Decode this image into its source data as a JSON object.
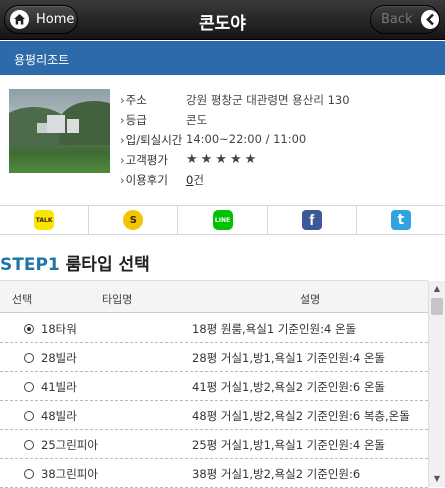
{
  "header": {
    "home_label": "Home",
    "title": "콘도야",
    "back_label": "Back"
  },
  "subbar": {
    "label": "용평리조트"
  },
  "info": {
    "rows": [
      {
        "key": "주소",
        "value": "강원 평창군 대관령면 용산리 130"
      },
      {
        "key": "등급",
        "value": "콘도"
      },
      {
        "key": "입/퇴실시간",
        "value": "14:00~22:00 / 11:00"
      },
      {
        "key": "고객평가",
        "value": "★★★★★"
      },
      {
        "key": "이용후기",
        "count": "0",
        "unit": "건"
      }
    ]
  },
  "share": {
    "items": [
      {
        "name": "kakaotalk",
        "label": "TALK",
        "color": "#f7e600",
        "text_color": "#3a1d1d"
      },
      {
        "name": "kakaostory",
        "label": "S",
        "color": "#f4c400",
        "text_color": "#3a1d1d"
      },
      {
        "name": "line",
        "label": "LINE",
        "color": "#00c300",
        "text_color": "#ffffff"
      },
      {
        "name": "facebook",
        "label": "f",
        "color": "#3b5998",
        "text_color": "#ffffff"
      },
      {
        "name": "twitter",
        "label": "t",
        "color": "#2fa4df",
        "text_color": "#ffffff"
      }
    ]
  },
  "step": {
    "number": "STEP1",
    "title": "룸타입 선택"
  },
  "table": {
    "headers": {
      "select": "선택",
      "type": "타입명",
      "desc": "설명"
    },
    "rows": [
      {
        "name": "18타워",
        "desc": "18평 원룸,욕실1 기준인원:4 온돌",
        "selected": true
      },
      {
        "name": "28빌라",
        "desc": "28평 거실1,방1,욕실1 기준인원:4 온돌",
        "selected": false
      },
      {
        "name": "41빌라",
        "desc": "41평 거실1,방2,욕실2 기준인원:6 온돌",
        "selected": false
      },
      {
        "name": "48빌라",
        "desc": "48평 거실1,방2,욕실2 기준인원:6 복층,온돌",
        "selected": false
      },
      {
        "name": "25그린피아",
        "desc": "25평 거실1,방1,욕실1 기준인원:4 온돌",
        "selected": false
      },
      {
        "name": "38그린피아",
        "desc": "38평 거실1,방2,욕실2 기준인원:6",
        "selected": false
      }
    ]
  }
}
